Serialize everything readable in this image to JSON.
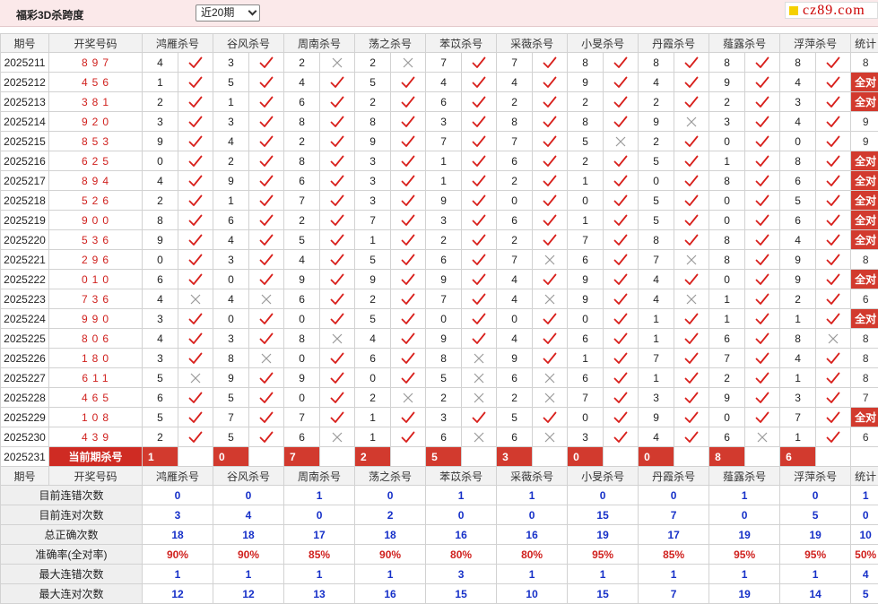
{
  "header": {
    "title": "福彩3D杀跨度",
    "period_select": "近20期",
    "logo": "cz89.com"
  },
  "columns": {
    "period": "期号",
    "numbers": "开奖号码",
    "experts": [
      "鸿雁杀号",
      "谷风杀号",
      "周南杀号",
      "荡之杀号",
      "苯苡杀号",
      "采薇杀号",
      "小旻杀号",
      "丹霞杀号",
      "薤露杀号",
      "浮萍杀号"
    ],
    "stat": "统计"
  },
  "rows": [
    {
      "period": "2025211",
      "nums": "897",
      "kills": [
        4,
        3,
        2,
        2,
        7,
        7,
        8,
        8,
        8,
        8
      ],
      "ok": [
        1,
        1,
        0,
        0,
        1,
        1,
        1,
        1,
        1,
        1
      ],
      "stat": "8"
    },
    {
      "period": "2025212",
      "nums": "456",
      "kills": [
        1,
        5,
        4,
        5,
        4,
        4,
        9,
        4,
        9,
        4
      ],
      "ok": [
        1,
        1,
        1,
        1,
        1,
        1,
        1,
        1,
        1,
        1
      ],
      "stat": "全对"
    },
    {
      "period": "2025213",
      "nums": "381",
      "kills": [
        2,
        1,
        6,
        2,
        6,
        2,
        2,
        2,
        2,
        3
      ],
      "ok": [
        1,
        1,
        1,
        1,
        1,
        1,
        1,
        1,
        1,
        1
      ],
      "stat": "全对"
    },
    {
      "period": "2025214",
      "nums": "920",
      "kills": [
        3,
        3,
        8,
        8,
        3,
        8,
        8,
        9,
        3,
        4
      ],
      "ok": [
        1,
        1,
        1,
        1,
        1,
        1,
        1,
        0,
        1,
        1
      ],
      "stat": "9"
    },
    {
      "period": "2025215",
      "nums": "853",
      "kills": [
        9,
        4,
        2,
        9,
        7,
        7,
        5,
        2,
        0,
        0
      ],
      "ok": [
        1,
        1,
        1,
        1,
        1,
        1,
        0,
        1,
        1,
        1
      ],
      "stat": "9"
    },
    {
      "period": "2025216",
      "nums": "625",
      "kills": [
        0,
        2,
        8,
        3,
        1,
        6,
        2,
        5,
        1,
        8
      ],
      "ok": [
        1,
        1,
        1,
        1,
        1,
        1,
        1,
        1,
        1,
        1
      ],
      "stat": "全对"
    },
    {
      "period": "2025217",
      "nums": "894",
      "kills": [
        4,
        9,
        6,
        3,
        1,
        2,
        1,
        0,
        8,
        6
      ],
      "ok": [
        1,
        1,
        1,
        1,
        1,
        1,
        1,
        1,
        1,
        1
      ],
      "stat": "全对"
    },
    {
      "period": "2025218",
      "nums": "526",
      "kills": [
        2,
        1,
        7,
        3,
        9,
        0,
        0,
        5,
        0,
        5
      ],
      "ok": [
        1,
        1,
        1,
        1,
        1,
        1,
        1,
        1,
        1,
        1
      ],
      "stat": "全对"
    },
    {
      "period": "2025219",
      "nums": "900",
      "kills": [
        8,
        6,
        2,
        7,
        3,
        6,
        1,
        5,
        0,
        6
      ],
      "ok": [
        1,
        1,
        1,
        1,
        1,
        1,
        1,
        1,
        1,
        1
      ],
      "stat": "全对"
    },
    {
      "period": "2025220",
      "nums": "536",
      "kills": [
        9,
        4,
        5,
        1,
        2,
        2,
        7,
        8,
        8,
        4
      ],
      "ok": [
        1,
        1,
        1,
        1,
        1,
        1,
        1,
        1,
        1,
        1
      ],
      "stat": "全对"
    },
    {
      "period": "2025221",
      "nums": "296",
      "kills": [
        0,
        3,
        4,
        5,
        6,
        7,
        6,
        7,
        8,
        9
      ],
      "ok": [
        1,
        1,
        1,
        1,
        1,
        0,
        1,
        0,
        1,
        1
      ],
      "stat": "8"
    },
    {
      "period": "2025222",
      "nums": "010",
      "kills": [
        6,
        0,
        9,
        9,
        9,
        4,
        9,
        4,
        0,
        9
      ],
      "ok": [
        1,
        1,
        1,
        1,
        1,
        1,
        1,
        1,
        1,
        1
      ],
      "stat": "全对"
    },
    {
      "period": "2025223",
      "nums": "736",
      "kills": [
        4,
        4,
        6,
        2,
        7,
        4,
        9,
        4,
        1,
        2
      ],
      "ok": [
        0,
        0,
        1,
        1,
        1,
        0,
        1,
        0,
        1,
        1
      ],
      "stat": "6"
    },
    {
      "period": "2025224",
      "nums": "990",
      "kills": [
        3,
        0,
        0,
        5,
        0,
        0,
        0,
        1,
        1,
        1
      ],
      "ok": [
        1,
        1,
        1,
        1,
        1,
        1,
        1,
        1,
        1,
        1
      ],
      "stat": "全对"
    },
    {
      "period": "2025225",
      "nums": "806",
      "kills": [
        4,
        3,
        8,
        4,
        9,
        4,
        6,
        1,
        6,
        8
      ],
      "ok": [
        1,
        1,
        0,
        1,
        1,
        1,
        1,
        1,
        1,
        0
      ],
      "stat": "8"
    },
    {
      "period": "2025226",
      "nums": "180",
      "kills": [
        3,
        8,
        0,
        6,
        8,
        9,
        1,
        7,
        7,
        4
      ],
      "ok": [
        1,
        0,
        1,
        1,
        0,
        1,
        1,
        1,
        1,
        1
      ],
      "stat": "8"
    },
    {
      "period": "2025227",
      "nums": "611",
      "kills": [
        5,
        9,
        9,
        0,
        5,
        6,
        6,
        1,
        2,
        1
      ],
      "ok": [
        0,
        1,
        1,
        1,
        0,
        0,
        1,
        1,
        1,
        1
      ],
      "stat": "8"
    },
    {
      "period": "2025228",
      "nums": "465",
      "kills": [
        6,
        5,
        0,
        2,
        2,
        2,
        7,
        3,
        9,
        3
      ],
      "ok": [
        1,
        1,
        1,
        0,
        0,
        0,
        1,
        1,
        1,
        1
      ],
      "stat": "7"
    },
    {
      "period": "2025229",
      "nums": "108",
      "kills": [
        5,
        7,
        7,
        1,
        3,
        5,
        0,
        9,
        0,
        7
      ],
      "ok": [
        1,
        1,
        1,
        1,
        1,
        1,
        1,
        1,
        1,
        1
      ],
      "stat": "全对"
    },
    {
      "period": "2025230",
      "nums": "439",
      "kills": [
        2,
        5,
        6,
        1,
        6,
        6,
        3,
        4,
        6,
        1
      ],
      "ok": [
        1,
        1,
        0,
        1,
        0,
        0,
        1,
        1,
        0,
        1
      ],
      "stat": "6"
    }
  ],
  "current": {
    "period": "2025231",
    "label": "当前期杀号",
    "kills": [
      "1",
      "0",
      "7",
      "2",
      "5",
      "3",
      "0",
      "0",
      "8",
      "6"
    ]
  },
  "stats": [
    {
      "label": "目前连错次数",
      "values": [
        "0",
        "0",
        "1",
        "0",
        "1",
        "1",
        "0",
        "0",
        "1",
        "0"
      ],
      "total": "1",
      "kind": "num"
    },
    {
      "label": "目前连对次数",
      "values": [
        "3",
        "4",
        "0",
        "2",
        "0",
        "0",
        "15",
        "7",
        "0",
        "5"
      ],
      "total": "0",
      "kind": "num"
    },
    {
      "label": "总正确次数",
      "values": [
        "18",
        "18",
        "17",
        "18",
        "16",
        "16",
        "19",
        "17",
        "19",
        "19"
      ],
      "total": "10",
      "kind": "num"
    },
    {
      "label": "准确率(全对率)",
      "values": [
        "90%",
        "90%",
        "85%",
        "90%",
        "80%",
        "80%",
        "95%",
        "85%",
        "95%",
        "95%"
      ],
      "total": "50%",
      "kind": "rate"
    },
    {
      "label": "最大连错次数",
      "values": [
        "1",
        "1",
        "1",
        "1",
        "3",
        "1",
        "1",
        "1",
        "1",
        "1"
      ],
      "total": "4",
      "kind": "num"
    },
    {
      "label": "最大连对次数",
      "values": [
        "12",
        "12",
        "13",
        "16",
        "15",
        "10",
        "15",
        "7",
        "19",
        "14"
      ],
      "total": "5",
      "kind": "num"
    }
  ],
  "colors": {
    "check": "#d8201c",
    "cross": "#9a9a9a",
    "highlight": "#d23a2e",
    "stat_blue": "#1630c8"
  },
  "icons": {
    "ok": "check-icon",
    "miss": "cross-icon",
    "dropdown": "chevron-down-icon"
  }
}
